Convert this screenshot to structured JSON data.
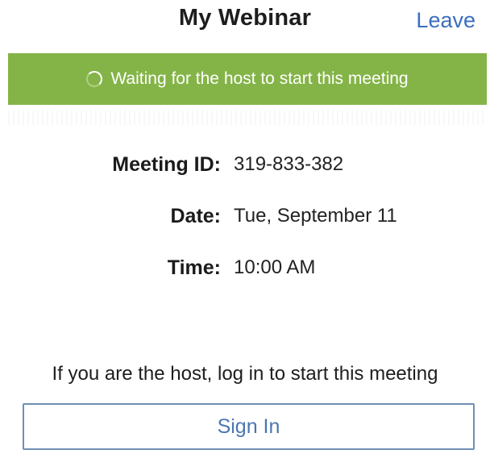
{
  "header": {
    "title": "My Webinar",
    "leave_label": "Leave"
  },
  "banner": {
    "text": "Waiting for the host to start this meeting",
    "color": "#84b447"
  },
  "meeting": {
    "id_label": "Meeting ID:",
    "id_value": "319-833-382",
    "date_label": "Date:",
    "date_value": "Tue, September 11",
    "time_label": "Time:",
    "time_value": "10:00 AM"
  },
  "footer": {
    "hint": "If you are the host, log in to start this meeting",
    "signin_label": "Sign In"
  },
  "colors": {
    "accent": "#3b6fbe",
    "button_border": "#6f8fb5"
  },
  "icons": {
    "spinner": "loading-spinner-icon"
  }
}
